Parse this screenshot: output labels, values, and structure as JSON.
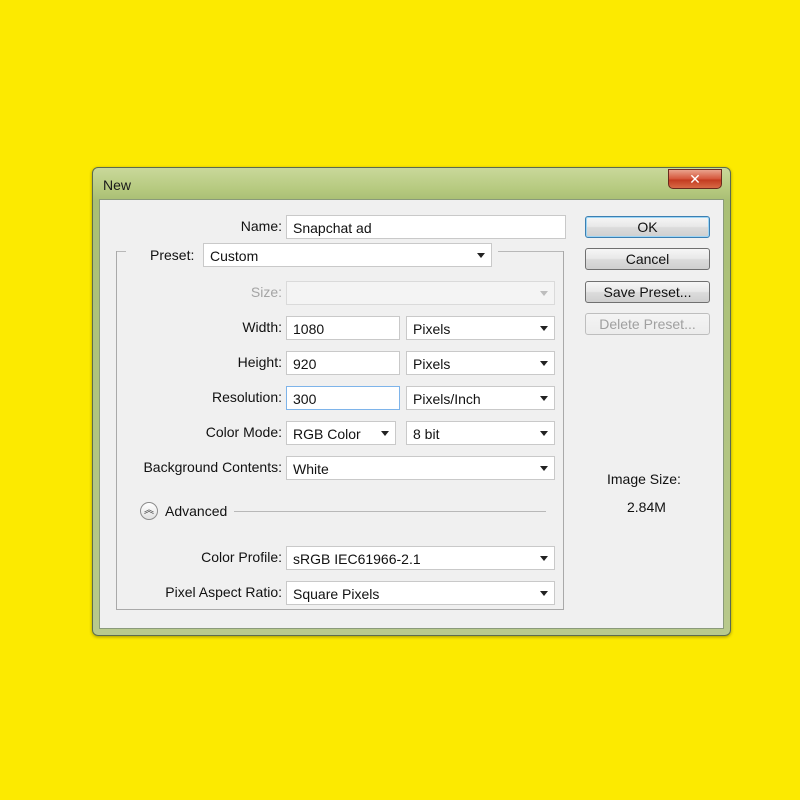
{
  "window": {
    "title": "New",
    "close_glyph": "✕"
  },
  "form": {
    "name_label": "Name:",
    "name_value": "Snapchat ad",
    "preset_label": "Preset:",
    "preset_value": "Custom",
    "size_label": "Size:",
    "size_value": "",
    "width_label": "Width:",
    "width_value": "1080",
    "width_unit": "Pixels",
    "height_label": "Height:",
    "height_value": "920",
    "height_unit": "Pixels",
    "resolution_label": "Resolution:",
    "resolution_value": "300",
    "resolution_unit": "Pixels/Inch",
    "color_mode_label": "Color Mode:",
    "color_mode_value": "RGB Color",
    "bit_depth_value": "8 bit",
    "background_label": "Background Contents:",
    "background_value": "White",
    "advanced_label": "Advanced",
    "color_profile_label": "Color Profile:",
    "color_profile_value": "sRGB IEC61966-2.1",
    "pixel_aspect_label": "Pixel Aspect Ratio:",
    "pixel_aspect_value": "Square Pixels"
  },
  "buttons": {
    "ok": "OK",
    "cancel": "Cancel",
    "save_preset": "Save Preset...",
    "delete_preset": "Delete Preset..."
  },
  "info": {
    "image_size_label": "Image Size:",
    "image_size_value": "2.84M"
  },
  "colors": {
    "background": "#fcea00",
    "dialog_face": "#f0f0f0",
    "close_button": "#c33a20",
    "focus_border": "#7eb4ea"
  }
}
